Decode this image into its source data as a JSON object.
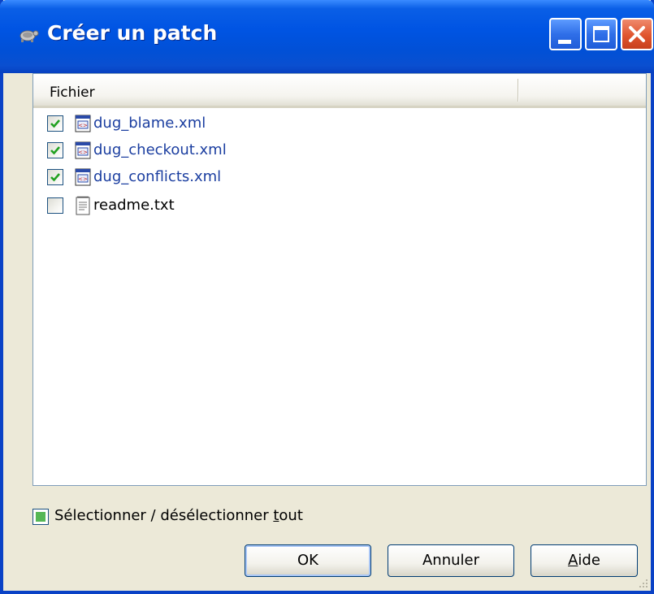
{
  "window": {
    "title": "Créer un patch"
  },
  "list": {
    "column_header": "Fichier",
    "files": [
      {
        "name": "dug_blame.xml",
        "checked": true,
        "icon": "xml-file-icon",
        "status": "modified"
      },
      {
        "name": "dug_checkout.xml",
        "checked": true,
        "icon": "xml-file-icon",
        "status": "modified"
      },
      {
        "name": "dug_conflicts.xml",
        "checked": true,
        "icon": "xml-file-icon",
        "status": "modified"
      },
      {
        "name": "readme.txt",
        "checked": false,
        "icon": "text-file-icon",
        "status": "unversioned"
      }
    ]
  },
  "select_all": {
    "label": "Sélectionner / désélectionner tout",
    "state": "indeterminate"
  },
  "buttons": {
    "ok": "OK",
    "cancel": "Annuler",
    "help": "Aide"
  },
  "colors": {
    "modified_text": "#1b3ea0",
    "titlebar": "#0054e3",
    "dialog_bg": "#ece9d8",
    "check_mark": "#21a121"
  }
}
